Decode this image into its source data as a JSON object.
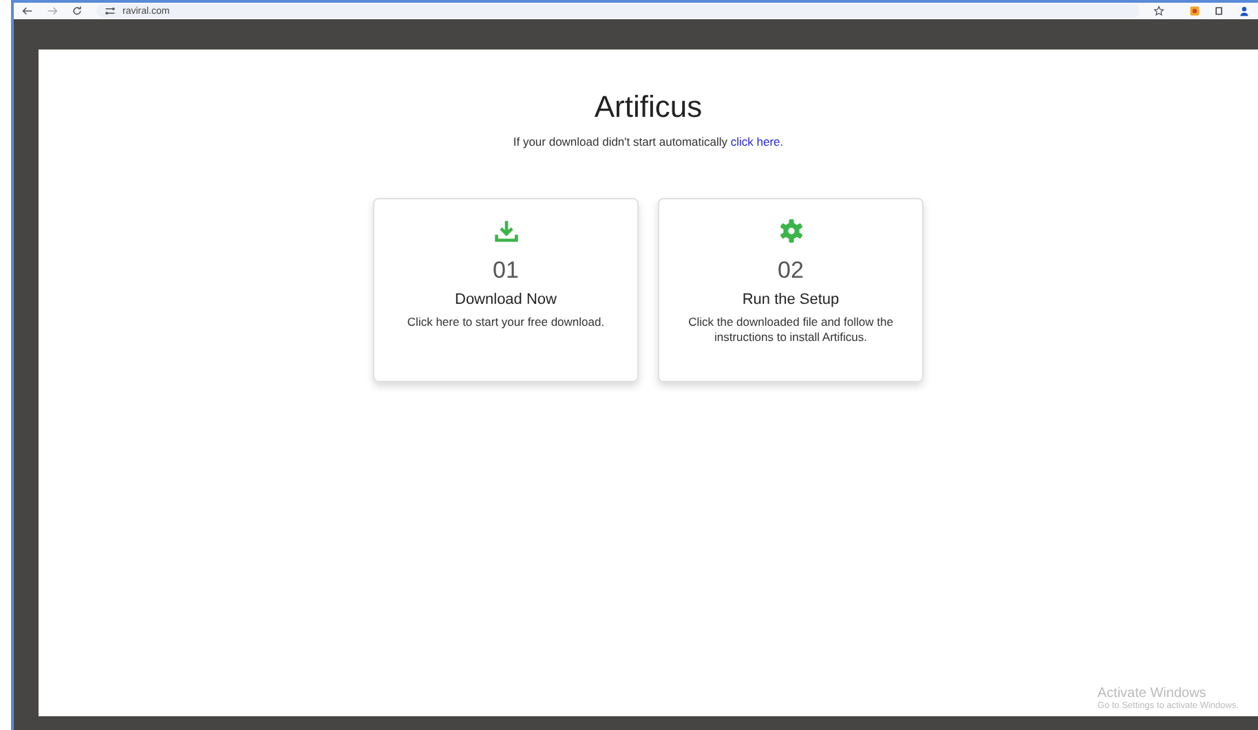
{
  "browser": {
    "url": "raviral.com"
  },
  "page": {
    "title": "Artificus",
    "subtitle": "If your download didn't start automatically",
    "link": "click here."
  },
  "steps": [
    {
      "kind": "download",
      "number": "01",
      "title": "Download Now",
      "text": "Click here to start your free download."
    },
    {
      "kind": "setup",
      "number": "02",
      "title": "Run the Setup",
      "text": "Click the downloaded file and follow the instructions to install Artificus."
    }
  ],
  "watermark": {
    "title": "Activate Windows",
    "text": "Go to Settings to activate Windows."
  }
}
